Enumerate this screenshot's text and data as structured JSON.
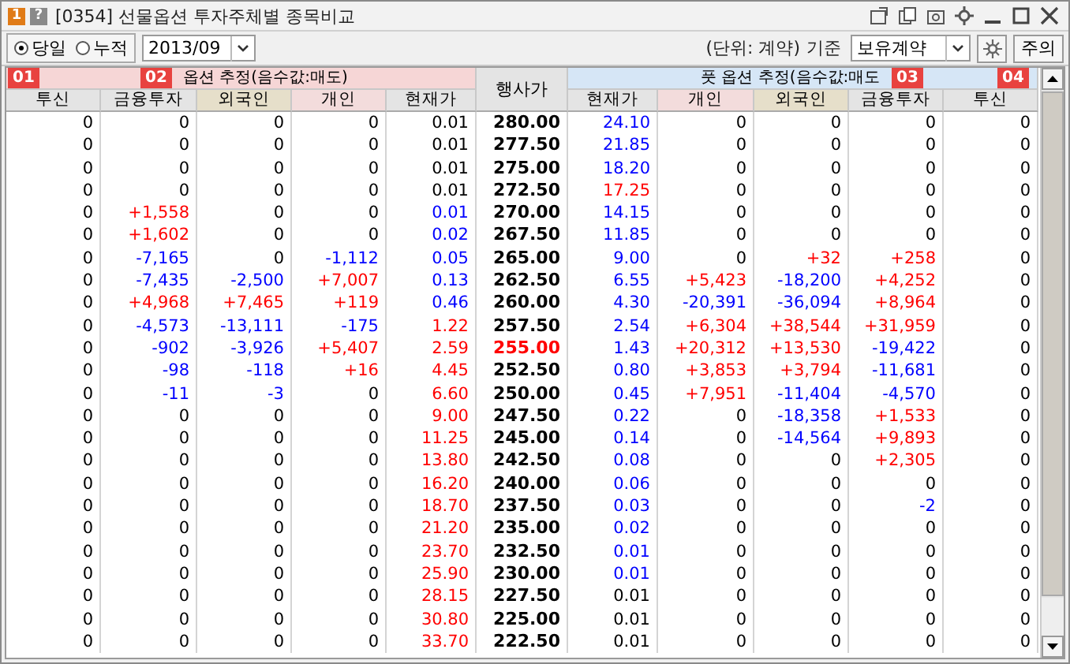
{
  "window": {
    "badge": "1",
    "help": "?",
    "title": "[0354] 선물옵션 투자주체별 종목비교"
  },
  "toolbar": {
    "period_options": [
      {
        "label": "당일",
        "selected": true
      },
      {
        "label": "누적",
        "selected": false
      }
    ],
    "month": "2013/09",
    "unit": "(단위: 계약)",
    "basis_label": "기준",
    "basis": "보유계약",
    "notice_button": "주의"
  },
  "callouts": [
    "01",
    "02",
    "03",
    "04"
  ],
  "table": {
    "call_group": "옵션 추정(음수값:매도)",
    "put_group": "풋 옵션 추정(음수값:매도",
    "strike_header": "행사가",
    "call_columns": [
      {
        "label": "투신",
        "kind": "institution"
      },
      {
        "label": "금융투자",
        "kind": "institution"
      },
      {
        "label": "외국인",
        "kind": "foreign"
      },
      {
        "label": "개인",
        "kind": "individual"
      },
      {
        "label": "현재가",
        "kind": "price"
      }
    ],
    "put_columns": [
      {
        "label": "현재가",
        "kind": "price"
      },
      {
        "label": "개인",
        "kind": "individual"
      },
      {
        "label": "외국인",
        "kind": "foreign"
      },
      {
        "label": "금융투자",
        "kind": "institution"
      },
      {
        "label": "투신",
        "kind": "institution"
      }
    ],
    "rows": [
      {
        "strike": "280.00",
        "at_the_money": false,
        "call": [
          {
            "text": "0",
            "color": "#000000"
          },
          {
            "text": "0",
            "color": "#000000"
          },
          {
            "text": "0",
            "color": "#000000"
          },
          {
            "text": "0",
            "color": "#000000"
          },
          {
            "text": "0.01",
            "color": "#000000"
          }
        ],
        "put": [
          {
            "text": "24.10",
            "color": "#0000ff"
          },
          {
            "text": "0",
            "color": "#000000"
          },
          {
            "text": "0",
            "color": "#000000"
          },
          {
            "text": "0",
            "color": "#000000"
          },
          {
            "text": "0",
            "color": "#000000"
          }
        ]
      },
      {
        "strike": "277.50",
        "at_the_money": false,
        "call": [
          {
            "text": "0",
            "color": "#000000"
          },
          {
            "text": "0",
            "color": "#000000"
          },
          {
            "text": "0",
            "color": "#000000"
          },
          {
            "text": "0",
            "color": "#000000"
          },
          {
            "text": "0.01",
            "color": "#000000"
          }
        ],
        "put": [
          {
            "text": "21.85",
            "color": "#0000ff"
          },
          {
            "text": "0",
            "color": "#000000"
          },
          {
            "text": "0",
            "color": "#000000"
          },
          {
            "text": "0",
            "color": "#000000"
          },
          {
            "text": "0",
            "color": "#000000"
          }
        ]
      },
      {
        "strike": "275.00",
        "at_the_money": false,
        "call": [
          {
            "text": "0",
            "color": "#000000"
          },
          {
            "text": "0",
            "color": "#000000"
          },
          {
            "text": "0",
            "color": "#000000"
          },
          {
            "text": "0",
            "color": "#000000"
          },
          {
            "text": "0.01",
            "color": "#000000"
          }
        ],
        "put": [
          {
            "text": "18.20",
            "color": "#0000ff"
          },
          {
            "text": "0",
            "color": "#000000"
          },
          {
            "text": "0",
            "color": "#000000"
          },
          {
            "text": "0",
            "color": "#000000"
          },
          {
            "text": "0",
            "color": "#000000"
          }
        ]
      },
      {
        "strike": "272.50",
        "at_the_money": false,
        "call": [
          {
            "text": "0",
            "color": "#000000"
          },
          {
            "text": "0",
            "color": "#000000"
          },
          {
            "text": "0",
            "color": "#000000"
          },
          {
            "text": "0",
            "color": "#000000"
          },
          {
            "text": "0.01",
            "color": "#000000"
          }
        ],
        "put": [
          {
            "text": "17.25",
            "color": "#ff0000"
          },
          {
            "text": "0",
            "color": "#000000"
          },
          {
            "text": "0",
            "color": "#000000"
          },
          {
            "text": "0",
            "color": "#000000"
          },
          {
            "text": "0",
            "color": "#000000"
          }
        ]
      },
      {
        "strike": "270.00",
        "at_the_money": false,
        "call": [
          {
            "text": "0",
            "color": "#000000"
          },
          {
            "text": "+1,558",
            "color": "#ff0000"
          },
          {
            "text": "0",
            "color": "#000000"
          },
          {
            "text": "0",
            "color": "#000000"
          },
          {
            "text": "0.01",
            "color": "#0000ff"
          }
        ],
        "put": [
          {
            "text": "14.15",
            "color": "#0000ff"
          },
          {
            "text": "0",
            "color": "#000000"
          },
          {
            "text": "0",
            "color": "#000000"
          },
          {
            "text": "0",
            "color": "#000000"
          },
          {
            "text": "0",
            "color": "#000000"
          }
        ]
      },
      {
        "strike": "267.50",
        "at_the_money": false,
        "call": [
          {
            "text": "0",
            "color": "#000000"
          },
          {
            "text": "+1,602",
            "color": "#ff0000"
          },
          {
            "text": "0",
            "color": "#000000"
          },
          {
            "text": "0",
            "color": "#000000"
          },
          {
            "text": "0.02",
            "color": "#0000ff"
          }
        ],
        "put": [
          {
            "text": "11.85",
            "color": "#0000ff"
          },
          {
            "text": "0",
            "color": "#000000"
          },
          {
            "text": "0",
            "color": "#000000"
          },
          {
            "text": "0",
            "color": "#000000"
          },
          {
            "text": "0",
            "color": "#000000"
          }
        ]
      },
      {
        "strike": "265.00",
        "at_the_money": false,
        "call": [
          {
            "text": "0",
            "color": "#000000"
          },
          {
            "text": "-7,165",
            "color": "#0000ff"
          },
          {
            "text": "0",
            "color": "#000000"
          },
          {
            "text": "-1,112",
            "color": "#0000ff"
          },
          {
            "text": "0.05",
            "color": "#0000ff"
          }
        ],
        "put": [
          {
            "text": "9.00",
            "color": "#0000ff"
          },
          {
            "text": "0",
            "color": "#000000"
          },
          {
            "text": "+32",
            "color": "#ff0000"
          },
          {
            "text": "+258",
            "color": "#ff0000"
          },
          {
            "text": "0",
            "color": "#000000"
          }
        ]
      },
      {
        "strike": "262.50",
        "at_the_money": false,
        "call": [
          {
            "text": "0",
            "color": "#000000"
          },
          {
            "text": "-7,435",
            "color": "#0000ff"
          },
          {
            "text": "-2,500",
            "color": "#0000ff"
          },
          {
            "text": "+7,007",
            "color": "#ff0000"
          },
          {
            "text": "0.13",
            "color": "#0000ff"
          }
        ],
        "put": [
          {
            "text": "6.55",
            "color": "#0000ff"
          },
          {
            "text": "+5,423",
            "color": "#ff0000"
          },
          {
            "text": "-18,200",
            "color": "#0000ff"
          },
          {
            "text": "+4,252",
            "color": "#ff0000"
          },
          {
            "text": "0",
            "color": "#000000"
          }
        ]
      },
      {
        "strike": "260.00",
        "at_the_money": false,
        "call": [
          {
            "text": "0",
            "color": "#000000"
          },
          {
            "text": "+4,968",
            "color": "#ff0000"
          },
          {
            "text": "+7,465",
            "color": "#ff0000"
          },
          {
            "text": "+119",
            "color": "#ff0000"
          },
          {
            "text": "0.46",
            "color": "#0000ff"
          }
        ],
        "put": [
          {
            "text": "4.30",
            "color": "#0000ff"
          },
          {
            "text": "-20,391",
            "color": "#0000ff"
          },
          {
            "text": "-36,094",
            "color": "#0000ff"
          },
          {
            "text": "+8,964",
            "color": "#ff0000"
          },
          {
            "text": "0",
            "color": "#000000"
          }
        ]
      },
      {
        "strike": "257.50",
        "at_the_money": false,
        "call": [
          {
            "text": "0",
            "color": "#000000"
          },
          {
            "text": "-4,573",
            "color": "#0000ff"
          },
          {
            "text": "-13,111",
            "color": "#0000ff"
          },
          {
            "text": "-175",
            "color": "#0000ff"
          },
          {
            "text": "1.22",
            "color": "#ff0000"
          }
        ],
        "put": [
          {
            "text": "2.54",
            "color": "#0000ff"
          },
          {
            "text": "+6,304",
            "color": "#ff0000"
          },
          {
            "text": "+38,544",
            "color": "#ff0000"
          },
          {
            "text": "+31,959",
            "color": "#ff0000"
          },
          {
            "text": "0",
            "color": "#000000"
          }
        ]
      },
      {
        "strike": "255.00",
        "at_the_money": true,
        "call": [
          {
            "text": "0",
            "color": "#000000"
          },
          {
            "text": "-902",
            "color": "#0000ff"
          },
          {
            "text": "-3,926",
            "color": "#0000ff"
          },
          {
            "text": "+5,407",
            "color": "#ff0000"
          },
          {
            "text": "2.59",
            "color": "#ff0000"
          }
        ],
        "put": [
          {
            "text": "1.43",
            "color": "#0000ff"
          },
          {
            "text": "+20,312",
            "color": "#ff0000"
          },
          {
            "text": "+13,530",
            "color": "#ff0000"
          },
          {
            "text": "-19,422",
            "color": "#0000ff"
          },
          {
            "text": "0",
            "color": "#000000"
          }
        ]
      },
      {
        "strike": "252.50",
        "at_the_money": false,
        "call": [
          {
            "text": "0",
            "color": "#000000"
          },
          {
            "text": "-98",
            "color": "#0000ff"
          },
          {
            "text": "-118",
            "color": "#0000ff"
          },
          {
            "text": "+16",
            "color": "#ff0000"
          },
          {
            "text": "4.45",
            "color": "#ff0000"
          }
        ],
        "put": [
          {
            "text": "0.80",
            "color": "#0000ff"
          },
          {
            "text": "+3,853",
            "color": "#ff0000"
          },
          {
            "text": "+3,794",
            "color": "#ff0000"
          },
          {
            "text": "-11,681",
            "color": "#0000ff"
          },
          {
            "text": "0",
            "color": "#000000"
          }
        ]
      },
      {
        "strike": "250.00",
        "at_the_money": false,
        "call": [
          {
            "text": "0",
            "color": "#000000"
          },
          {
            "text": "-11",
            "color": "#0000ff"
          },
          {
            "text": "-3",
            "color": "#0000ff"
          },
          {
            "text": "0",
            "color": "#000000"
          },
          {
            "text": "6.60",
            "color": "#ff0000"
          }
        ],
        "put": [
          {
            "text": "0.45",
            "color": "#0000ff"
          },
          {
            "text": "+7,951",
            "color": "#ff0000"
          },
          {
            "text": "-11,404",
            "color": "#0000ff"
          },
          {
            "text": "-4,570",
            "color": "#0000ff"
          },
          {
            "text": "0",
            "color": "#000000"
          }
        ]
      },
      {
        "strike": "247.50",
        "at_the_money": false,
        "call": [
          {
            "text": "0",
            "color": "#000000"
          },
          {
            "text": "0",
            "color": "#000000"
          },
          {
            "text": "0",
            "color": "#000000"
          },
          {
            "text": "0",
            "color": "#000000"
          },
          {
            "text": "9.00",
            "color": "#ff0000"
          }
        ],
        "put": [
          {
            "text": "0.22",
            "color": "#0000ff"
          },
          {
            "text": "0",
            "color": "#000000"
          },
          {
            "text": "-18,358",
            "color": "#0000ff"
          },
          {
            "text": "+1,533",
            "color": "#ff0000"
          },
          {
            "text": "0",
            "color": "#000000"
          }
        ]
      },
      {
        "strike": "245.00",
        "at_the_money": false,
        "call": [
          {
            "text": "0",
            "color": "#000000"
          },
          {
            "text": "0",
            "color": "#000000"
          },
          {
            "text": "0",
            "color": "#000000"
          },
          {
            "text": "0",
            "color": "#000000"
          },
          {
            "text": "11.25",
            "color": "#ff0000"
          }
        ],
        "put": [
          {
            "text": "0.14",
            "color": "#0000ff"
          },
          {
            "text": "0",
            "color": "#000000"
          },
          {
            "text": "-14,564",
            "color": "#0000ff"
          },
          {
            "text": "+9,893",
            "color": "#ff0000"
          },
          {
            "text": "0",
            "color": "#000000"
          }
        ]
      },
      {
        "strike": "242.50",
        "at_the_money": false,
        "call": [
          {
            "text": "0",
            "color": "#000000"
          },
          {
            "text": "0",
            "color": "#000000"
          },
          {
            "text": "0",
            "color": "#000000"
          },
          {
            "text": "0",
            "color": "#000000"
          },
          {
            "text": "13.80",
            "color": "#ff0000"
          }
        ],
        "put": [
          {
            "text": "0.08",
            "color": "#0000ff"
          },
          {
            "text": "0",
            "color": "#000000"
          },
          {
            "text": "0",
            "color": "#000000"
          },
          {
            "text": "+2,305",
            "color": "#ff0000"
          },
          {
            "text": "0",
            "color": "#000000"
          }
        ]
      },
      {
        "strike": "240.00",
        "at_the_money": false,
        "call": [
          {
            "text": "0",
            "color": "#000000"
          },
          {
            "text": "0",
            "color": "#000000"
          },
          {
            "text": "0",
            "color": "#000000"
          },
          {
            "text": "0",
            "color": "#000000"
          },
          {
            "text": "16.20",
            "color": "#ff0000"
          }
        ],
        "put": [
          {
            "text": "0.06",
            "color": "#0000ff"
          },
          {
            "text": "0",
            "color": "#000000"
          },
          {
            "text": "0",
            "color": "#000000"
          },
          {
            "text": "0",
            "color": "#000000"
          },
          {
            "text": "0",
            "color": "#000000"
          }
        ]
      },
      {
        "strike": "237.50",
        "at_the_money": false,
        "call": [
          {
            "text": "0",
            "color": "#000000"
          },
          {
            "text": "0",
            "color": "#000000"
          },
          {
            "text": "0",
            "color": "#000000"
          },
          {
            "text": "0",
            "color": "#000000"
          },
          {
            "text": "18.70",
            "color": "#ff0000"
          }
        ],
        "put": [
          {
            "text": "0.03",
            "color": "#0000ff"
          },
          {
            "text": "0",
            "color": "#000000"
          },
          {
            "text": "0",
            "color": "#000000"
          },
          {
            "text": "-2",
            "color": "#0000ff"
          },
          {
            "text": "0",
            "color": "#000000"
          }
        ]
      },
      {
        "strike": "235.00",
        "at_the_money": false,
        "call": [
          {
            "text": "0",
            "color": "#000000"
          },
          {
            "text": "0",
            "color": "#000000"
          },
          {
            "text": "0",
            "color": "#000000"
          },
          {
            "text": "0",
            "color": "#000000"
          },
          {
            "text": "21.20",
            "color": "#ff0000"
          }
        ],
        "put": [
          {
            "text": "0.02",
            "color": "#0000ff"
          },
          {
            "text": "0",
            "color": "#000000"
          },
          {
            "text": "0",
            "color": "#000000"
          },
          {
            "text": "0",
            "color": "#000000"
          },
          {
            "text": "0",
            "color": "#000000"
          }
        ]
      },
      {
        "strike": "232.50",
        "at_the_money": false,
        "call": [
          {
            "text": "0",
            "color": "#000000"
          },
          {
            "text": "0",
            "color": "#000000"
          },
          {
            "text": "0",
            "color": "#000000"
          },
          {
            "text": "0",
            "color": "#000000"
          },
          {
            "text": "23.70",
            "color": "#ff0000"
          }
        ],
        "put": [
          {
            "text": "0.01",
            "color": "#0000ff"
          },
          {
            "text": "0",
            "color": "#000000"
          },
          {
            "text": "0",
            "color": "#000000"
          },
          {
            "text": "0",
            "color": "#000000"
          },
          {
            "text": "0",
            "color": "#000000"
          }
        ]
      },
      {
        "strike": "230.00",
        "at_the_money": false,
        "call": [
          {
            "text": "0",
            "color": "#000000"
          },
          {
            "text": "0",
            "color": "#000000"
          },
          {
            "text": "0",
            "color": "#000000"
          },
          {
            "text": "0",
            "color": "#000000"
          },
          {
            "text": "25.90",
            "color": "#ff0000"
          }
        ],
        "put": [
          {
            "text": "0.01",
            "color": "#0000ff"
          },
          {
            "text": "0",
            "color": "#000000"
          },
          {
            "text": "0",
            "color": "#000000"
          },
          {
            "text": "0",
            "color": "#000000"
          },
          {
            "text": "0",
            "color": "#000000"
          }
        ]
      },
      {
        "strike": "227.50",
        "at_the_money": false,
        "call": [
          {
            "text": "0",
            "color": "#000000"
          },
          {
            "text": "0",
            "color": "#000000"
          },
          {
            "text": "0",
            "color": "#000000"
          },
          {
            "text": "0",
            "color": "#000000"
          },
          {
            "text": "28.15",
            "color": "#ff0000"
          }
        ],
        "put": [
          {
            "text": "0.01",
            "color": "#000000"
          },
          {
            "text": "0",
            "color": "#000000"
          },
          {
            "text": "0",
            "color": "#000000"
          },
          {
            "text": "0",
            "color": "#000000"
          },
          {
            "text": "0",
            "color": "#000000"
          }
        ]
      },
      {
        "strike": "225.00",
        "at_the_money": false,
        "call": [
          {
            "text": "0",
            "color": "#000000"
          },
          {
            "text": "0",
            "color": "#000000"
          },
          {
            "text": "0",
            "color": "#000000"
          },
          {
            "text": "0",
            "color": "#000000"
          },
          {
            "text": "30.80",
            "color": "#ff0000"
          }
        ],
        "put": [
          {
            "text": "0.01",
            "color": "#000000"
          },
          {
            "text": "0",
            "color": "#000000"
          },
          {
            "text": "0",
            "color": "#000000"
          },
          {
            "text": "0",
            "color": "#000000"
          },
          {
            "text": "0",
            "color": "#000000"
          }
        ]
      },
      {
        "strike": "222.50",
        "at_the_money": false,
        "call": [
          {
            "text": "0",
            "color": "#000000"
          },
          {
            "text": "0",
            "color": "#000000"
          },
          {
            "text": "0",
            "color": "#000000"
          },
          {
            "text": "0",
            "color": "#000000"
          },
          {
            "text": "33.70",
            "color": "#ff0000"
          }
        ],
        "put": [
          {
            "text": "0.01",
            "color": "#000000"
          },
          {
            "text": "0",
            "color": "#000000"
          },
          {
            "text": "0",
            "color": "#000000"
          },
          {
            "text": "0",
            "color": "#000000"
          },
          {
            "text": "0",
            "color": "#000000"
          }
        ]
      }
    ]
  }
}
